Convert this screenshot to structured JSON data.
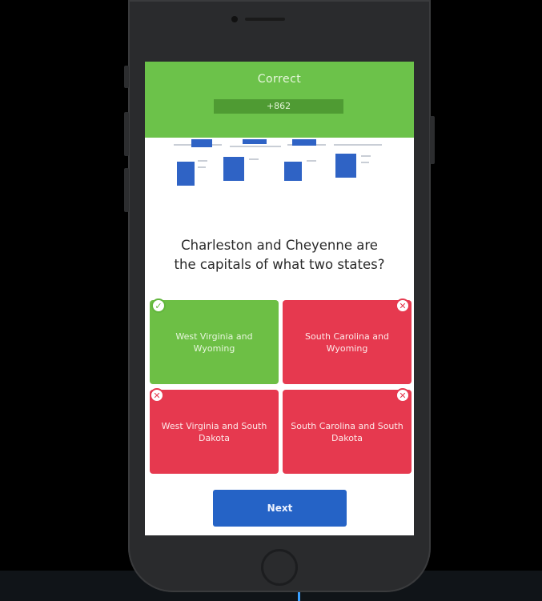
{
  "result": {
    "title": "Correct",
    "score": "+862"
  },
  "question": {
    "line1": "Charleston and Cheyenne are",
    "line2": "the capitals of what two states?"
  },
  "answers": [
    {
      "label": "West Virginia and Wyoming",
      "state": "correct",
      "icon": "check-icon"
    },
    {
      "label": "South Carolina and Wyoming",
      "state": "wrong",
      "icon": "close-icon"
    },
    {
      "label": "West Virginia and South Dakota",
      "state": "wrong",
      "icon": "close-icon"
    },
    {
      "label": "South Carolina and South Dakota",
      "state": "wrong",
      "icon": "close-icon"
    }
  ],
  "next_button": {
    "label": "Next"
  },
  "colors": {
    "correct": "#6dbf45",
    "wrong": "#e6394f",
    "primary": "#2563c6",
    "banner": "#6cc24a"
  }
}
